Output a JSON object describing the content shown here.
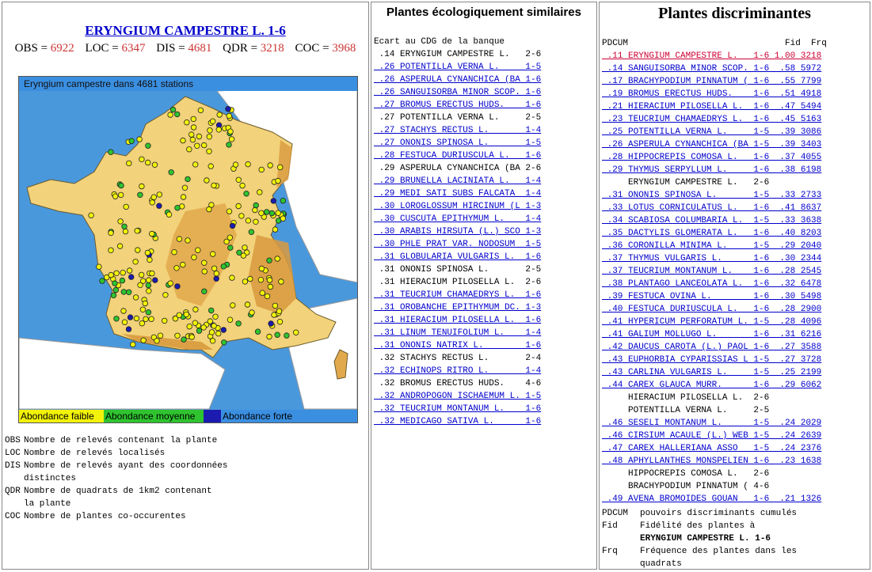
{
  "left": {
    "title": "ERYNGIUM CAMPESTRE L. 1-6",
    "stats": [
      {
        "label": "OBS",
        "value": "6922"
      },
      {
        "label": "LOC",
        "value": "6347"
      },
      {
        "label": "DIS",
        "value": "4681"
      },
      {
        "label": "QDR",
        "value": "3218"
      },
      {
        "label": "COC",
        "value": "3968"
      }
    ],
    "map_caption": "Eryngium campestre dans 4681 stations",
    "legend": [
      {
        "label": "Abondance faible",
        "color": "#f2f20a"
      },
      {
        "label": "Abondance moyenne",
        "color": "#2fc42f"
      },
      {
        "label": "Abondance forte",
        "color": "#1b1bb0"
      }
    ],
    "definitions": [
      {
        "key": "OBS",
        "text": "Nombre de relevés contenant la plante"
      },
      {
        "key": "LOC",
        "text": "Nombre de relevés localisés"
      },
      {
        "key": "DIS",
        "text": "Nombre de relevés ayant des coordonnées"
      },
      {
        "key": "",
        "text": "distinctes"
      },
      {
        "key": "QDR",
        "text": "Nombre de quadrats de 1km2 contenant"
      },
      {
        "key": "",
        "text": "la plante"
      },
      {
        "key": "COC",
        "text": "Nombre de plantes co-occurentes"
      }
    ]
  },
  "similar": {
    "title": "Plantes écologiquement similaires",
    "header": "Ecart au CDG de la banque",
    "rows": [
      {
        "text": " .14 ERYNGIUM CAMPESTRE L.   2-6",
        "link": false
      },
      {
        "text": " .26 POTENTILLA VERNA L.     1-5",
        "link": true
      },
      {
        "text": " .26 ASPERULA CYNANCHICA (BA 1-6",
        "link": true
      },
      {
        "text": " .26 SANGUISORBA MINOR SCOP. 1-6",
        "link": true
      },
      {
        "text": " .27 BROMUS ERECTUS HUDS.    1-6",
        "link": true
      },
      {
        "text": " .27 POTENTILLA VERNA L.     2-5",
        "link": false
      },
      {
        "text": " .27 STACHYS RECTUS L.       1-4",
        "link": true
      },
      {
        "text": " .27 ONONIS SPINOSA L.       1-5",
        "link": true
      },
      {
        "text": " .28 FESTUCA DURIUSCULA L.   1-6",
        "link": true
      },
      {
        "text": " .29 ASPERULA CYNANCHICA (BA 2-6",
        "link": false
      },
      {
        "text": " .29 BRUNELLA LACINIATA L.   1-4",
        "link": true
      },
      {
        "text": " .29 MEDI SATI SUBS FALCATA  1-4",
        "link": true
      },
      {
        "text": " .30 LOROGLOSSUM HIRCINUM (L 1-3",
        "link": true
      },
      {
        "text": " .30 CUSCUTA EPITHYMUM L.    1-4",
        "link": true
      },
      {
        "text": " .30 ARABIS HIRSUTA (L.) SCO 1-3",
        "link": true
      },
      {
        "text": " .30 PHLE PRAT VAR. NODOSUM  1-5",
        "link": true
      },
      {
        "text": " .31 GLOBULARIA VULGARIS L.  1-6",
        "link": true
      },
      {
        "text": " .31 ONONIS SPINOSA L.       2-5",
        "link": false
      },
      {
        "text": " .31 HIERACIUM PILOSELLA L.  2-6",
        "link": false
      },
      {
        "text": " .31 TEUCRIUM CHAMAEDRYS L.  1-6",
        "link": true
      },
      {
        "text": " .31 OROBANCHE EPITHYMUM DC. 1-3",
        "link": true
      },
      {
        "text": " .31 HIERACIUM PILOSELLA L.  1-6",
        "link": true
      },
      {
        "text": " .31 LINUM TENUIFOLIUM L.    1-4",
        "link": true
      },
      {
        "text": " .31 ONONIS NATRIX L.        1-6",
        "link": true
      },
      {
        "text": " .32 STACHYS RECTUS L.       2-4",
        "link": false
      },
      {
        "text": " .32 ECHINOPS RITRO L.       1-4",
        "link": true
      },
      {
        "text": " .32 BROMUS ERECTUS HUDS.    4-6",
        "link": false
      },
      {
        "text": " .32 ANDROPOGON ISCHAEMUM L. 1-5",
        "link": true
      },
      {
        "text": " .32 TEUCRIUM MONTANUM L.    1-6",
        "link": true
      },
      {
        "text": " .32 MEDICAGO SATIVA L.      1-6",
        "link": true
      }
    ]
  },
  "discriminant": {
    "title": "Plantes discriminantes",
    "header": "PDCUM                              Fid  Frq",
    "rows": [
      {
        "text": " .11 ERYNGIUM CAMPESTRE L.   1-6 1.00 3218",
        "kind": "hl"
      },
      {
        "text": " .14 SANGUISORBA MINOR SCOP. 1-6  .58 5972",
        "kind": "link"
      },
      {
        "text": " .17 BRACHYPODIUM PINNATUM ( 1-6  .55 7799",
        "kind": "link"
      },
      {
        "text": " .19 BROMUS ERECTUS HUDS.    1-6  .51 4918",
        "kind": "link"
      },
      {
        "text": " .21 HIERACIUM PILOSELLA L.  1-6  .47 5494",
        "kind": "link"
      },
      {
        "text": " .23 TEUCRIUM CHAMAEDRYS L.  1-6  .45 5163",
        "kind": "link"
      },
      {
        "text": " .25 POTENTILLA VERNA L.     1-5  .39 3086",
        "kind": "link"
      },
      {
        "text": " .26 ASPERULA CYNANCHICA (BA 1-5  .39 3403",
        "kind": "link"
      },
      {
        "text": " .28 HIPPOCREPIS COMOSA L.   1-6  .37 4055",
        "kind": "link"
      },
      {
        "text": " .29 THYMUS SERPYLLUM L.     1-6  .38 6198",
        "kind": "link"
      },
      {
        "text": "     ERYNGIUM CAMPESTRE L.   2-6",
        "kind": "plain"
      },
      {
        "text": " .31 ONONIS SPINOSA L.       1-5  .33 2733",
        "kind": "link"
      },
      {
        "text": " .33 LOTUS CORNICULATUS L.   1-6  .41 8637",
        "kind": "link"
      },
      {
        "text": " .34 SCABIOSA COLUMBARIA L.  1-5  .33 3638",
        "kind": "link"
      },
      {
        "text": " .35 DACTYLIS GLOMERATA L.   1-6  .40 8203",
        "kind": "link"
      },
      {
        "text": " .36 CORONILLA MINIMA L.     1-5  .29 2040",
        "kind": "link"
      },
      {
        "text": " .37 THYMUS VULGARIS L.      1-6  .30 2344",
        "kind": "link"
      },
      {
        "text": " .37 TEUCRIUM MONTANUM L.    1-6  .28 2545",
        "kind": "link"
      },
      {
        "text": " .38 PLANTAGO LANCEOLATA L.  1-6  .32 6478",
        "kind": "link"
      },
      {
        "text": " .39 FESTUCA OVINA L.        1-6  .30 5498",
        "kind": "link"
      },
      {
        "text": " .40 FESTUCA DURIUSCULA L.   1-6  .28 2900",
        "kind": "link"
      },
      {
        "text": " .41 HYPERICUM PERFORATUM L. 1-5  .28 4096",
        "kind": "link"
      },
      {
        "text": " .41 GALIUM MOLLUGO L.       1-6  .31 6216",
        "kind": "link"
      },
      {
        "text": " .42 DAUCUS CAROTA (L.) PAOL 1-6  .27 3588",
        "kind": "link"
      },
      {
        "text": " .43 EUPHORBIA CYPARISSIAS L 1-5  .27 3728",
        "kind": "link"
      },
      {
        "text": " .43 CARLINA VULGARIS L.     1-5  .25 2199",
        "kind": "link"
      },
      {
        "text": " .44 CAREX GLAUCA MURR.      1-6  .29 6062",
        "kind": "link"
      },
      {
        "text": "     HIERACIUM PILOSELLA L.  2-6",
        "kind": "plain"
      },
      {
        "text": "     POTENTILLA VERNA L.     2-5",
        "kind": "plain"
      },
      {
        "text": " .46 SESELI MONTANUM L.      1-5  .24 2029",
        "kind": "link"
      },
      {
        "text": " .46 CIRSIUM ACAULE (L.) WEB 1-5  .24 2639",
        "kind": "link"
      },
      {
        "text": " .47 CAREX HALLERIANA ASSO   1-5  .24 2376",
        "kind": "link"
      },
      {
        "text": " .48 APHYLLANTHES MONSPELIEN 1-6  .23 1638",
        "kind": "link"
      },
      {
        "text": "     HIPPOCREPIS COMOSA L.   2-6",
        "kind": "plain"
      },
      {
        "text": "     BRACHYPODIUM PINNATUM ( 4-6",
        "kind": "plain"
      },
      {
        "text": " .49 AVENA BROMOIDES GOUAN   1-6  .21 1326",
        "kind": "link"
      }
    ],
    "footer": [
      {
        "key": "PDCUM",
        "text": "pouvoirs discriminants cumulés",
        "bold": false
      },
      {
        "key": "Fid",
        "text": "Fidélité des plantes à",
        "bold": false
      },
      {
        "key": "",
        "text": "ERYNGIUM CAMPESTRE L.   1-6",
        "bold": true
      },
      {
        "key": "Frq",
        "text": "Fréquence des plantes dans les",
        "bold": false
      },
      {
        "key": "",
        "text": "quadrats",
        "bold": false
      }
    ]
  }
}
